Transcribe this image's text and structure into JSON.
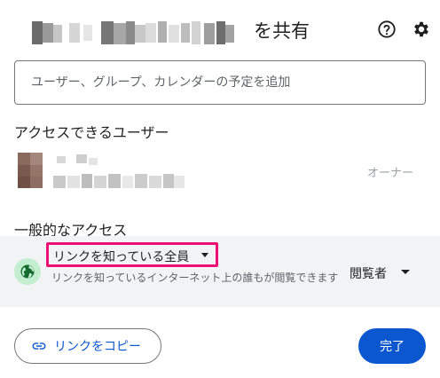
{
  "dialog": {
    "title_suffix": "を共有",
    "help_icon": "help-circle-icon",
    "settings_icon": "gear-icon"
  },
  "add_people": {
    "placeholder": "ユーザー、グループ、カレンダーの予定を追加"
  },
  "people_with_access": {
    "heading": "アクセスできるユーザー",
    "users": [
      {
        "role": "オーナー"
      }
    ]
  },
  "general_access": {
    "heading": "一般的なアクセス",
    "icon": "globe-icon",
    "link_scope": "リンクを知っている全員",
    "description": "リンクを知っているインターネット上の誰もが閲覧できます",
    "role": "閲覧者",
    "highlight_color": "#ee0f73"
  },
  "footer": {
    "copy_link_label": "リンクをコピー",
    "copy_icon": "link-icon",
    "done_label": "完了"
  },
  "colors": {
    "accent": "#0b57d0",
    "access_bg": "#f1f3f4",
    "globe_bg": "#c4eed0",
    "globe_fg": "#146c2e"
  }
}
